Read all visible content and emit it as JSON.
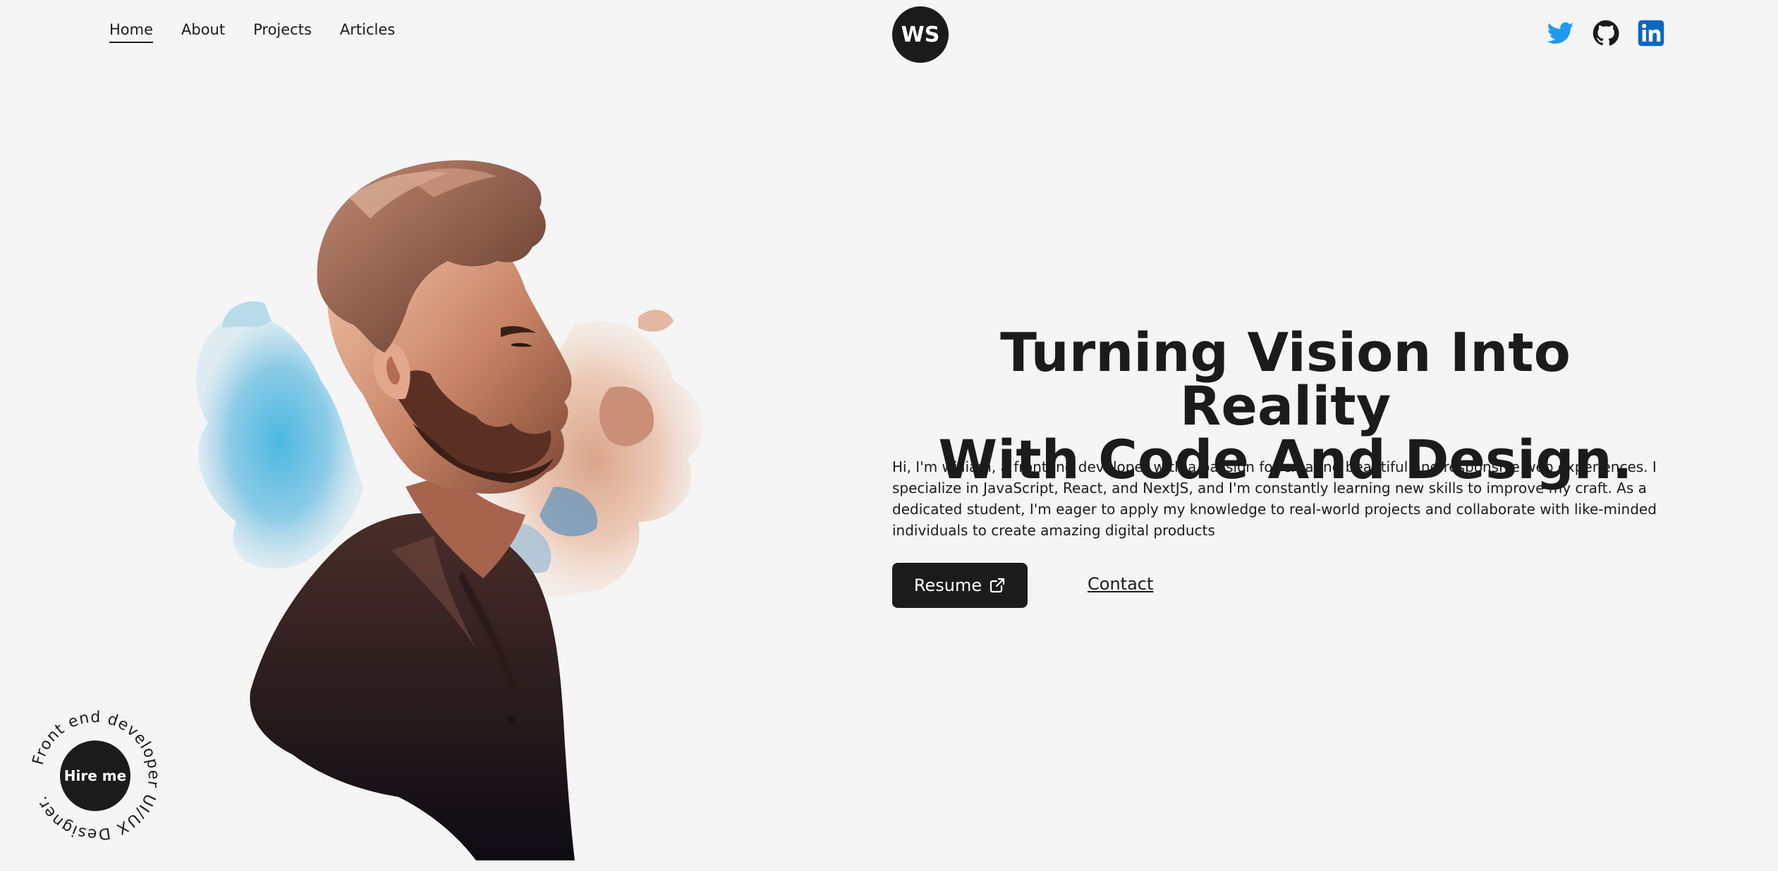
{
  "nav": {
    "items": [
      {
        "label": "Home",
        "active": true
      },
      {
        "label": "About",
        "active": false
      },
      {
        "label": "Projects",
        "active": false
      },
      {
        "label": "Articles",
        "active": false
      }
    ]
  },
  "logo": {
    "text": "WS"
  },
  "social": [
    {
      "icon": "twitter-icon",
      "color": "#1d9bf0"
    },
    {
      "icon": "github-icon",
      "color": "#1b1b1b"
    },
    {
      "icon": "linkedin-icon",
      "color": "#0a66c2"
    }
  ],
  "hero": {
    "headline_line1": "Turning Vision Into Reality",
    "headline_line2": "With Code And Design.",
    "bio": "Hi, I'm william, a frontend developer with a passion for creating beautiful and responsive web experiences. I specialize in JavaScript, React, and NextJS, and I'm constantly learning new skills to improve my craft. As a dedicated student, I'm eager to apply my knowledge to real-world projects and collaborate with like-minded individuals to create amazing digital products",
    "resume_label": "Resume",
    "contact_label": "Contact"
  },
  "hire": {
    "button_label": "Hire me",
    "ring_text": "Front end developer UI/UX Designer."
  },
  "colors": {
    "background": "#f5f5f5",
    "dark": "#1b1b1b"
  }
}
